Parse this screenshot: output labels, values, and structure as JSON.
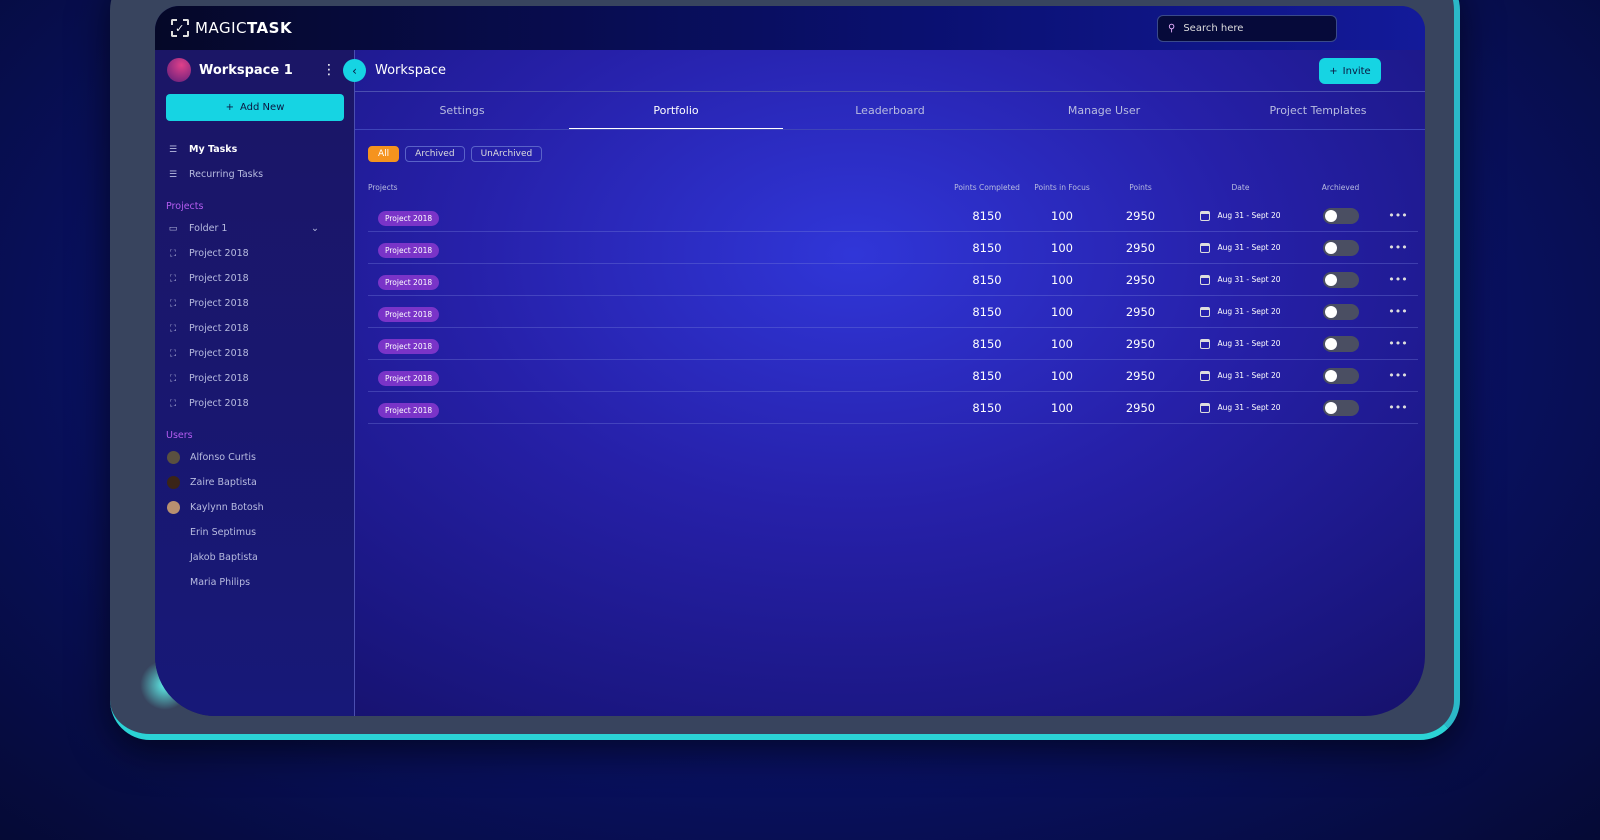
{
  "app": {
    "logo_light": "MAGIC",
    "logo_bold": "TASK",
    "search_placeholder": "Search here"
  },
  "sidebar": {
    "workspace": "Workspace 1",
    "add_new": "Add New",
    "nav": [
      {
        "label": "My Tasks",
        "active": true
      },
      {
        "label": "Recurring Tasks"
      }
    ],
    "projects_title": "Projects",
    "folder": "Folder 1",
    "projects": [
      "Project 2018",
      "Project 2018",
      "Project 2018",
      "Project 2018",
      "Project 2018",
      "Project 2018",
      "Project 2018"
    ],
    "users_title": "Users",
    "users": [
      "Alfonso Curtis",
      "Zaire Baptista",
      "Kaylynn Botosh",
      "Erin Septimus",
      "Jakob Baptista",
      "Maria Philips"
    ]
  },
  "main": {
    "title": "Workspace",
    "invite": "Invite",
    "tabs": [
      "Settings",
      "Portfolio",
      "Leaderboard",
      "Manage User",
      "Project Templates"
    ],
    "active_tab": "Portfolio",
    "filters": [
      "All",
      "Archived",
      "UnArchived"
    ],
    "active_filter": "All",
    "columns": [
      "Projects",
      "Points Completed",
      "Points in Focus",
      "Points",
      "Date",
      "Archieved"
    ],
    "rows": [
      {
        "project": "Project 2018",
        "completed": "8150",
        "focus": "100",
        "points": "2950",
        "date": "Aug 31 - Sept 20",
        "archived": false
      },
      {
        "project": "Project 2018",
        "completed": "8150",
        "focus": "100",
        "points": "2950",
        "date": "Aug 31 - Sept 20",
        "archived": false
      },
      {
        "project": "Project 2018",
        "completed": "8150",
        "focus": "100",
        "points": "2950",
        "date": "Aug 31 - Sept 20",
        "archived": false
      },
      {
        "project": "Project 2018",
        "completed": "8150",
        "focus": "100",
        "points": "2950",
        "date": "Aug 31 - Sept 20",
        "archived": false
      },
      {
        "project": "Project 2018",
        "completed": "8150",
        "focus": "100",
        "points": "2950",
        "date": "Aug 31 - Sept 20",
        "archived": false
      },
      {
        "project": "Project 2018",
        "completed": "8150",
        "focus": "100",
        "points": "2950",
        "date": "Aug 31 - Sept 20",
        "archived": false
      },
      {
        "project": "Project 2018",
        "completed": "8150",
        "focus": "100",
        "points": "2950",
        "date": "Aug 31 - Sept 20",
        "archived": false
      }
    ]
  },
  "colors": {
    "accent": "#16d4e3",
    "filter_active": "#f5931e",
    "badge": "#7a34c8",
    "section": "#b45cf0"
  }
}
